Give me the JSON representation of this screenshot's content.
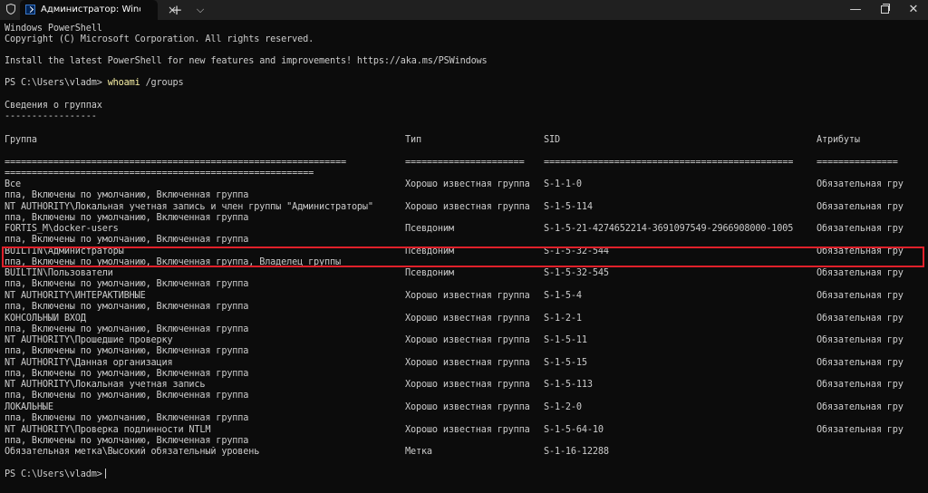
{
  "window": {
    "tab_title": "Администратор: Windows PowerShell",
    "tab_close": "×",
    "new_tab": "+",
    "dropdown": "⌵",
    "minimize": "—",
    "close": "✕"
  },
  "terminal": {
    "banner": [
      "Windows PowerShell",
      "Copyright (C) Microsoft Corporation. All rights reserved.",
      "",
      "Install the latest PowerShell for new features and improvements! https://aka.ms/PSWindows"
    ],
    "prompt": "PS C:\\Users\\vladm>",
    "command": "whoami",
    "command_args": "/groups",
    "section_title": "Сведения о группах",
    "section_underline": "-----------------",
    "headers": {
      "group": "Группа",
      "type": "Тип",
      "sid": "SID",
      "attributes": "Атрибуты"
    },
    "separators": {
      "group": "===============================================================",
      "type": "======================",
      "sid": "==============================================",
      "attributes": "===============",
      "group_wrap": "========================================================="
    },
    "rows": [
      {
        "group": "Все",
        "type": "Хорошо известная группа",
        "sid": "S-1-1-0",
        "attributes": "Обязательная гру",
        "continuation": "ппа, Включены по умолчанию, Включенная группа"
      },
      {
        "group": "NT AUTHORITY\\Локальная учетная запись и член группы \"Администраторы\"",
        "type": "Хорошо известная группа",
        "sid": "S-1-5-114",
        "attributes": "Обязательная гру",
        "continuation": "ппа, Включены по умолчанию, Включенная группа"
      },
      {
        "group": "FORTIS_M\\docker-users",
        "type": "Псевдоним",
        "sid": "S-1-5-21-4274652214-3691097549-2966908000-1005",
        "attributes": "Обязательная гру",
        "continuation": "ппа, Включены по умолчанию, Включенная группа"
      },
      {
        "group": "BUILTIN\\Администраторы",
        "type": "Псевдоним",
        "sid": "S-1-5-32-544",
        "attributes": "Обязательная гру",
        "continuation": "ппа, Включены по умолчанию, Включенная группа, Владелец группы"
      },
      {
        "group": "BUILTIN\\Пользователи",
        "type": "Псевдоним",
        "sid": "S-1-5-32-545",
        "attributes": "Обязательная гру",
        "continuation": "ппа, Включены по умолчанию, Включенная группа"
      },
      {
        "group": "NT AUTHORITY\\ИНТЕРАКТИВНЫЕ",
        "type": "Хорошо известная группа",
        "sid": "S-1-5-4",
        "attributes": "Обязательная гру",
        "continuation": "ппа, Включены по умолчанию, Включенная группа"
      },
      {
        "group": "КОНСОЛЬНЫЙ ВХОД",
        "type": "Хорошо известная группа",
        "sid": "S-1-2-1",
        "attributes": "Обязательная гру",
        "continuation": "ппа, Включены по умолчанию, Включенная группа"
      },
      {
        "group": "NT AUTHORITY\\Прошедшие проверку",
        "type": "Хорошо известная группа",
        "sid": "S-1-5-11",
        "attributes": "Обязательная гру",
        "continuation": "ппа, Включены по умолчанию, Включенная группа"
      },
      {
        "group": "NT AUTHORITY\\Данная организация",
        "type": "Хорошо известная группа",
        "sid": "S-1-5-15",
        "attributes": "Обязательная гру",
        "continuation": "ппа, Включены по умолчанию, Включенная группа"
      },
      {
        "group": "NT AUTHORITY\\Локальная учетная запись",
        "type": "Хорошо известная группа",
        "sid": "S-1-5-113",
        "attributes": "Обязательная гру",
        "continuation": "ппа, Включены по умолчанию, Включенная группа"
      },
      {
        "group": "ЛОКАЛЬНЫЕ",
        "type": "Хорошо известная группа",
        "sid": "S-1-2-0",
        "attributes": "Обязательная гру",
        "continuation": "ппа, Включены по умолчанию, Включенная группа"
      },
      {
        "group": "NT AUTHORITY\\Проверка подлинности NTLM",
        "type": "Хорошо известная группа",
        "sid": "S-1-5-64-10",
        "attributes": "Обязательная гру",
        "continuation": "ппа, Включены по умолчанию, Включенная группа"
      },
      {
        "group": "Обязательная метка\\Высокий обязательный уровень",
        "type": "Метка",
        "sid": "S-1-16-12288",
        "attributes": "",
        "continuation": null
      }
    ],
    "final_prompt": "PS C:\\Users\\vladm>"
  },
  "colors": {
    "background": "#0c0c0c",
    "text": "#cccccc",
    "command": "#f9f1a5",
    "highlight": "#e0202a",
    "titlebar": "#202020"
  }
}
